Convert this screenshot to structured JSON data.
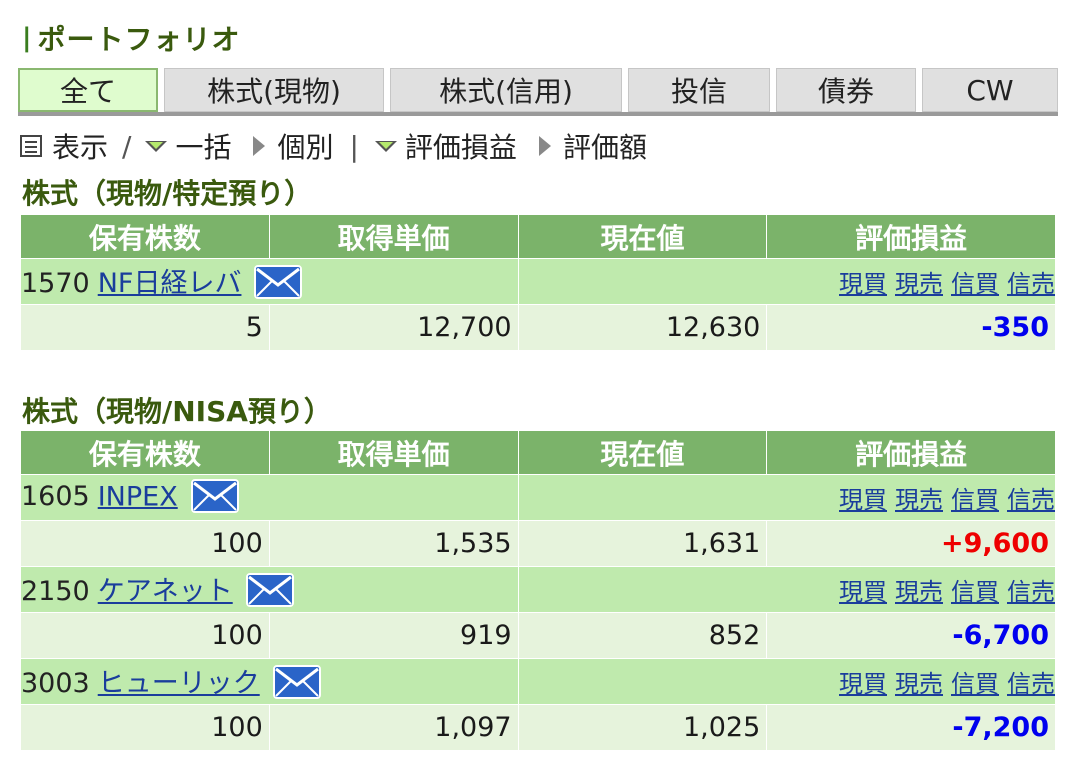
{
  "page_title": "ポートフォリオ",
  "tabs": [
    {
      "label": "全て",
      "active": true
    },
    {
      "label": "株式(現物)",
      "active": false
    },
    {
      "label": "株式(信用)",
      "active": false
    },
    {
      "label": "投信",
      "active": false
    },
    {
      "label": "債券",
      "active": false
    },
    {
      "label": "CW",
      "active": false
    }
  ],
  "display_bar": {
    "label": "表示",
    "slash": "/",
    "bulk": "一括",
    "individual": "個別",
    "divider": "|",
    "valuation_pl": "評価損益",
    "valuation_amount": "評価額"
  },
  "table_headers": {
    "shares": "保有株数",
    "avg_cost": "取得単価",
    "current_price": "現在値",
    "pl": "評価損益"
  },
  "trade_links": {
    "cash_buy": "現買",
    "cash_sell": "現売",
    "margin_buy": "信買",
    "margin_sell": "信売"
  },
  "sections": [
    {
      "title": "株式（現物/特定預り）",
      "rows": [
        {
          "code": "1570",
          "name": "NF日経レバ",
          "shares": "5",
          "avg_cost": "12,700",
          "current_price": "12,630",
          "pl": "-350",
          "pl_sign": "neg"
        }
      ]
    },
    {
      "title": "株式（現物/NISA預り）",
      "rows": [
        {
          "code": "1605",
          "name": "INPEX",
          "shares": "100",
          "avg_cost": "1,535",
          "current_price": "1,631",
          "pl": "+9,600",
          "pl_sign": "pos"
        },
        {
          "code": "2150",
          "name": "ケアネット",
          "shares": "100",
          "avg_cost": "919",
          "current_price": "852",
          "pl": "-6,700",
          "pl_sign": "neg"
        },
        {
          "code": "3003",
          "name": "ヒューリック",
          "shares": "100",
          "avg_cost": "1,097",
          "current_price": "1,025",
          "pl": "-7,200",
          "pl_sign": "neg"
        }
      ]
    }
  ],
  "colors": {
    "header_green": "#7bb36a",
    "name_row": "#bfeaad",
    "value_row": "#e6f3dc",
    "positive": "#ee0000",
    "negative": "#0000ee",
    "link": "#1a3d9c"
  },
  "icons": {
    "mail": "mail-icon",
    "list": "list-icon"
  }
}
